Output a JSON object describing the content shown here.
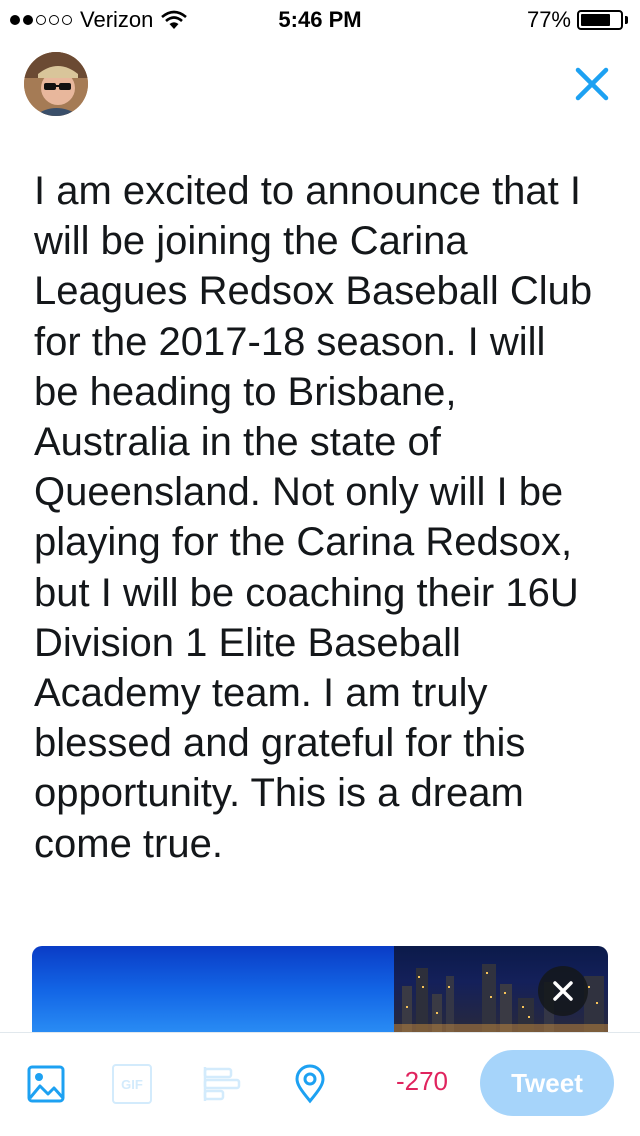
{
  "status_bar": {
    "carrier": "Verizon",
    "time": "5:46 PM",
    "battery": "77%",
    "battery_level": 0.77,
    "signal_bars_filled": 2,
    "signal_bars_total": 5
  },
  "header": {
    "avatar_icon": "user-avatar",
    "close_icon": "close-icon"
  },
  "compose": {
    "text": "I am excited to announce that I\nwill be joining the Carina\nLeagues Redsox Baseball Club\nfor the 2017-18 season. I will\nbe heading to Brisbane,\nAustralia in the state of\nQueensland. Not only will I be\nplaying for the Carina Redsox,\nbut I will be coaching their 16U\nDivision 1 Elite Baseball\nAcademy team. I am truly\nblessed and grateful for this\nopportunity. This is a dream\ncome true."
  },
  "toolbar": {
    "icons": [
      "image-icon",
      "gif-icon",
      "poll-icon",
      "location-icon",
      "close-icon"
    ],
    "gif_label": "GIF",
    "char_count": "-270",
    "tweet_label": "Tweet"
  },
  "colors": {
    "accent": "#1da1f2",
    "disabled_accent": "#a6d4fa",
    "over_limit": "#e0245e",
    "text": "#14171a"
  }
}
